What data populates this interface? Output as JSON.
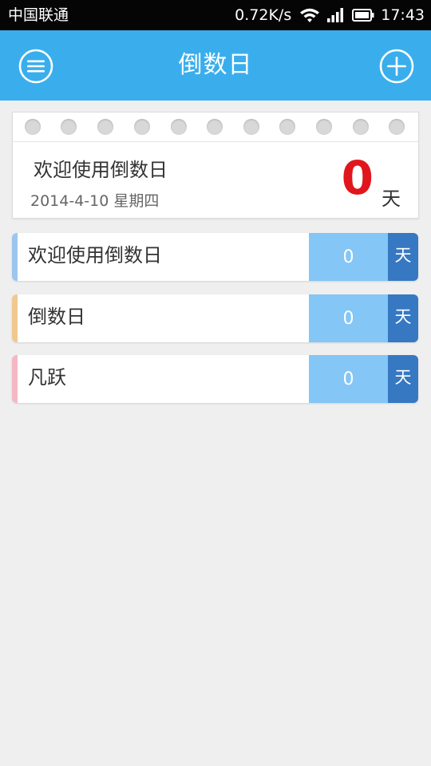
{
  "status_bar": {
    "carrier": "中国联通",
    "net_speed": "0.72K/s",
    "time": "17:43"
  },
  "header": {
    "title": "倒数日",
    "menu_icon": "menu-icon",
    "add_icon": "plus-circle-icon",
    "background": "#3aaeec"
  },
  "featured": {
    "title": "欢迎使用倒数日",
    "date": "2014-4-10 星期四",
    "count": "0",
    "unit": "天",
    "count_color": "#e0161c"
  },
  "items": [
    {
      "label": "欢迎使用倒数日",
      "count": "0",
      "unit": "天",
      "accent": "#9cc6ee"
    },
    {
      "label": "倒数日",
      "count": "0",
      "unit": "天",
      "accent": "#f0c890"
    },
    {
      "label": "凡跃",
      "count": "0",
      "unit": "天",
      "accent": "#f4b8c4"
    }
  ],
  "colors": {
    "count_box": "#84c6f6",
    "unit_box": "#3678c2"
  }
}
